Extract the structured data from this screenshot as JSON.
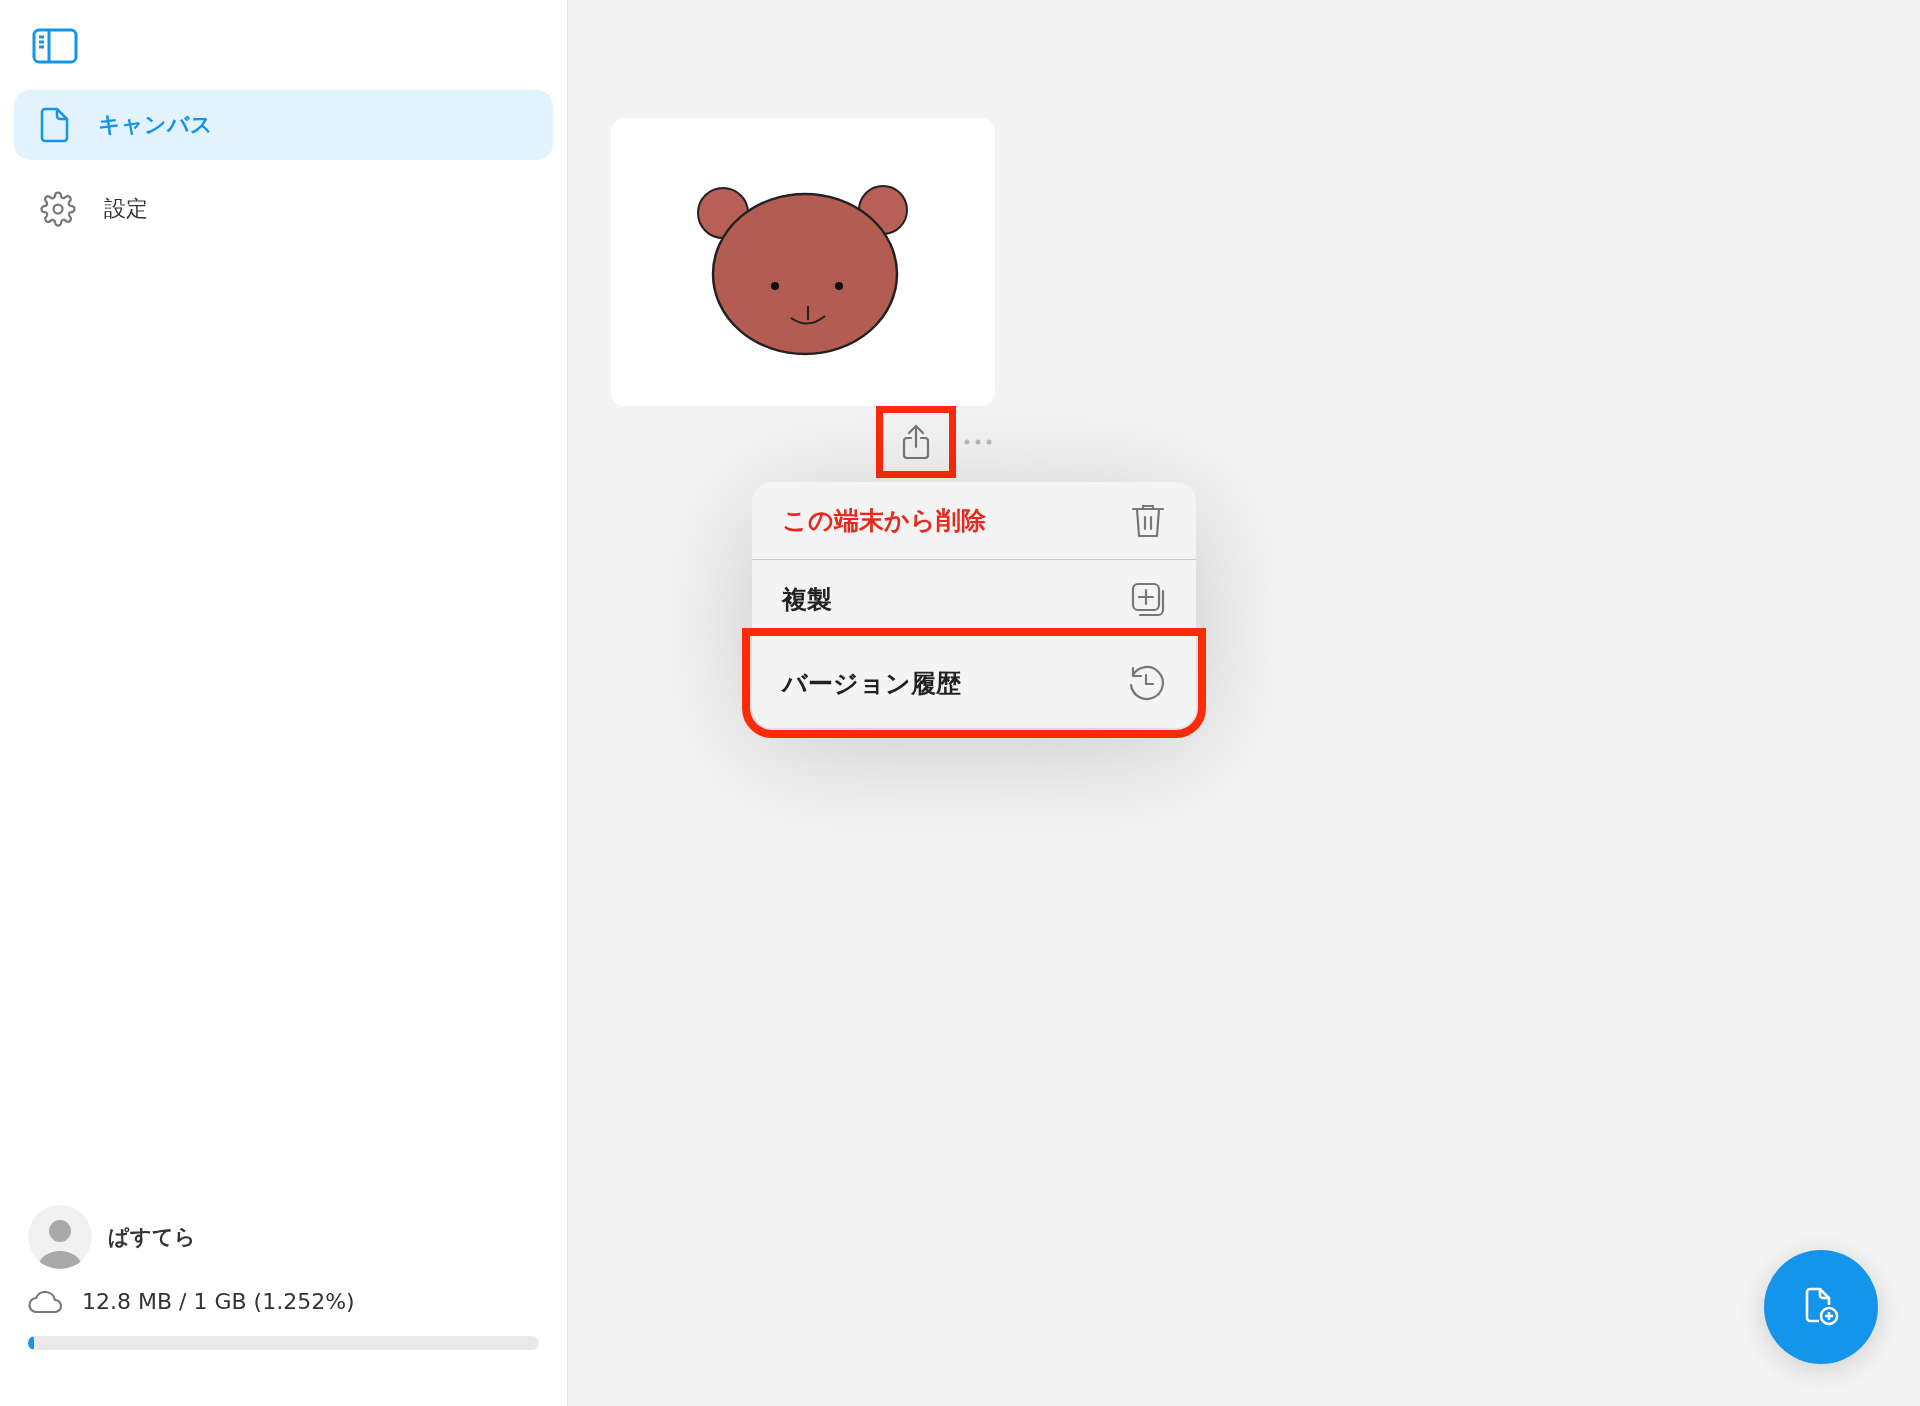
{
  "sidebar": {
    "items": [
      {
        "label": "キャンバス",
        "kind": "canvas",
        "selected": true
      },
      {
        "label": "設定",
        "kind": "settings",
        "selected": false
      }
    ],
    "user": {
      "name": "ぱすてら"
    },
    "storage": {
      "reading": "12.8 MB / 1 GB (1.252%)",
      "level": 0.01252
    }
  },
  "canvas_card": {
    "kind": "picture",
    "share_highlighted": true
  },
  "context_menu": {
    "items": [
      {
        "label": "この端末から削除",
        "kind": "delete",
        "destructive": true,
        "highlighted": false
      },
      {
        "label": "複製",
        "kind": "duplicate",
        "destructive": false,
        "highlighted": false
      },
      {
        "label": "バージョン履歴",
        "kind": "history",
        "destructive": false,
        "highlighted": true
      }
    ]
  }
}
